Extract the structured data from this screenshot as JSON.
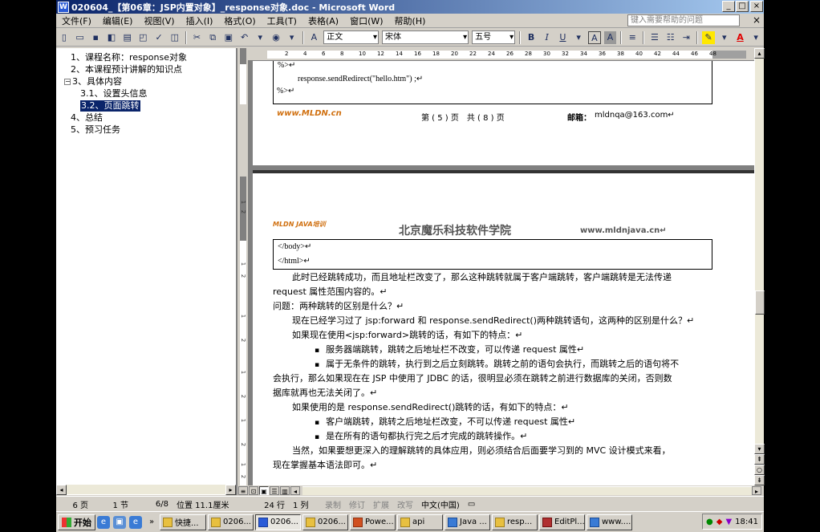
{
  "window": {
    "title": "020604_【第06章：JSP内置对象】_response对象.doc - Microsoft Word",
    "minimize": "_",
    "maximize": "□",
    "close": "×"
  },
  "menu": {
    "items": [
      "文件(F)",
      "编辑(E)",
      "视图(V)",
      "插入(I)",
      "格式(O)",
      "工具(T)",
      "表格(A)",
      "窗口(W)",
      "帮助(H)"
    ],
    "help_placeholder": "键入需要帮助的问题",
    "close_doc": "×"
  },
  "toolbar": {
    "style": "正文",
    "font": "宋体",
    "size": "五号",
    "bold": "B",
    "italic": "I",
    "underline": "U",
    "char_border": "A",
    "char_shade": "A",
    "font_color": "A"
  },
  "docmap": {
    "items": [
      "1、课程名称：response对象",
      "2、本课程预计讲解的知识点",
      "3、具体内容",
      "3.1、设置头信息",
      "3.2、页面跳转",
      "4、总结",
      "5、预习任务"
    ],
    "expander": "−"
  },
  "ruler": {
    "ticks": [
      "2",
      "4",
      "6",
      "8",
      "10",
      "12",
      "14",
      "16",
      "18",
      "20",
      "22",
      "24",
      "26",
      "28",
      "30",
      "32",
      "34",
      "36",
      "38",
      "40",
      "42",
      "44",
      "46",
      "48"
    ],
    "vticks": [
      "1",
      "2",
      "1",
      "2",
      "1",
      "2",
      "1",
      "2",
      "1",
      "2",
      "1",
      "2"
    ]
  },
  "page_a": {
    "line1": "%>↵",
    "line2": "response.sendRedirect(\"hello.htm\") ;↵",
    "line3": "%>↵",
    "footer_logo": "www.MLDN.cn",
    "footer_page": "第 ( 5 ) 页　共 ( 8 ) 页",
    "footer_mail_label": "邮箱：",
    "footer_mail": "mldnqa@163.com↵"
  },
  "page_b": {
    "logo": "MLDN JAVA培训",
    "header_title": "北京魔乐科技软件学院",
    "header_url": "www.mldnjava.cn↵",
    "code1": "</body>↵",
    "code2": "</html>↵",
    "lines": [
      "此时已经跳转成功，而且地址栏改变了，那么这种跳转就属于客户端跳转，客户端跳转是无法传递",
      "request 属性范围内容的。↵",
      "问题：两种跳转的区别是什么？↵",
      "现在已经学习过了 jsp:forward 和 response.sendRedirect()两种跳转语句，这两种的区别是什么？↵",
      "如果现在使用<jsp:forward>跳转的话，有如下的特点：↵",
      "服务器端跳转，跳转之后地址栏不改变，可以传递 request 属性↵",
      "属于无条件的跳转，执行到之后立刻跳转。跳转之前的语句会执行，而跳转之后的语句将不",
      "会执行，那么如果现在在 JSP 中使用了 JDBC 的话，很明显必须在跳转之前进行数据库的关闭，否则数",
      "据库就再也无法关闭了。↵",
      "如果使用的是 response.sendRedirect()跳转的话，有如下的特点：↵",
      "客户端跳转，跳转之后地址栏改变，不可以传递 request 属性↵",
      "是在所有的语句都执行完之后才完成的跳转操作。↵",
      "当然，如果要想更深入的理解跳转的具体应用，则必须结合后面要学习到的 MVC 设计模式来看，",
      "现在掌握基本语法即可。↵"
    ]
  },
  "status": {
    "page": "6 页",
    "section": "1 节",
    "pages": "6/8",
    "position": "位置 11.1厘米",
    "line": "24 行",
    "col": "1 列",
    "rec": "录制",
    "trk": "修订",
    "ext": "扩展",
    "ovr": "改写",
    "lang": "中文(中国)"
  },
  "taskbar": {
    "start": "开始",
    "tasks": [
      "快捷...",
      "0206...",
      "0206...",
      "0206...",
      "Powe...",
      "api",
      "Java ...",
      "resp...",
      "EditPl...",
      "www...."
    ],
    "clock": "18:41"
  }
}
